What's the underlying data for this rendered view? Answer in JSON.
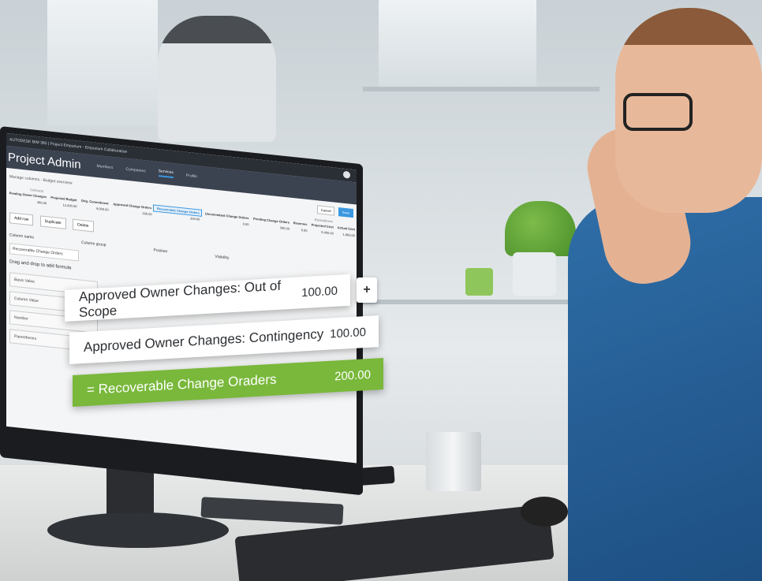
{
  "app": {
    "topbar_product": "AUTODESK BIM 360",
    "topbar_project": "Project Emporium - Emporium Collaboration",
    "title": "Project Admin",
    "nav": [
      "Members",
      "Companies",
      "Services",
      "Profile"
    ],
    "active_nav": "Services"
  },
  "breadcrumb": "Manage columns - Budget overview",
  "header_buttons": {
    "cancel": "Cancel",
    "save": "Save"
  },
  "budget_table": {
    "group_labels": [
      "Contracts",
      "Expenditures"
    ],
    "columns": [
      "Pending Owner Changes",
      "Projected Budget",
      "Orig. Commitment",
      "Approved Change Orders",
      "Recoverable Change Orders",
      "Uncommitted Change Orders",
      "Pending Change Orders",
      "Reserves",
      "Projected Cost",
      "Actual Cost"
    ],
    "row": [
      "400.00",
      "12,000.00",
      "9,000.00",
      "300.00",
      "200.00",
      "0.00",
      "300.00",
      "0.00",
      "9,400.00",
      "1,800.00"
    ]
  },
  "row_actions": [
    "Add row",
    "Duplicate",
    "Delete"
  ],
  "form": {
    "headers": [
      "Column name",
      "Column group",
      "Position",
      "Visibility"
    ],
    "column_name_value": "Recoverable Change Orders",
    "drag_label": "Drag and drop to add formula",
    "tokens": [
      "Basic Value",
      "Column Value",
      "Number",
      "Parentheses"
    ]
  },
  "formula_cards": [
    {
      "label": "Approved Owner Changes: Out of Scope",
      "value": "100.00"
    },
    {
      "label": "Approved Owner Changes: Contingency",
      "value": "100.00"
    },
    {
      "label": "= Recoverable Change Oraders",
      "value": "200.00"
    }
  ],
  "plus_symbol": "+",
  "colors": {
    "accent": "#3b98e0",
    "result_green": "#79b83b",
    "app_header": "#3b4250"
  }
}
